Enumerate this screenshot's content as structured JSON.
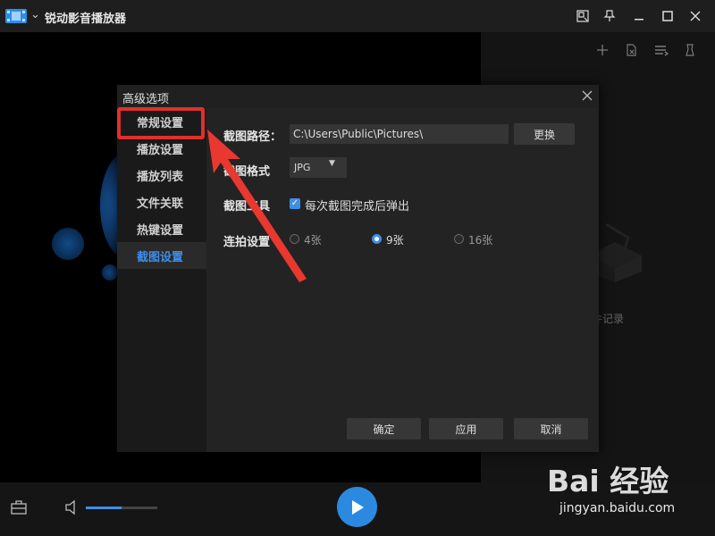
{
  "app": {
    "title": "锐动影音播放器"
  },
  "dialog": {
    "title": "高级选项",
    "nav": [
      "常规设置",
      "播放设置",
      "播放列表",
      "文件关联",
      "热键设置",
      "截图设置"
    ],
    "active_nav": 5,
    "path_label": "截图路径：",
    "path_value": "C:\\Users\\Public\\Pictures\\",
    "change_button": "更换",
    "format_label": "截图格式",
    "format_value": "JPG",
    "tool_label": "截图工具",
    "tool_checkbox_label": "每次截图完成后弹出",
    "tool_checkbox_checked": true,
    "burst_label": "连拍设置",
    "burst_options": [
      "4张",
      "9张",
      "16张"
    ],
    "burst_selected": "9张",
    "ok_button": "确定",
    "apply_button": "应用",
    "cancel_button": "取消"
  },
  "playlist": {
    "empty_text": "件记录"
  },
  "player": {
    "volume_level": 0.5
  },
  "watermark": {
    "logo": "Bai 经验",
    "url": "jingyan.baidu.com"
  },
  "colors": {
    "accent": "#3f8ee6",
    "highlight": "#e0302a",
    "play": "#2b8ae0"
  }
}
